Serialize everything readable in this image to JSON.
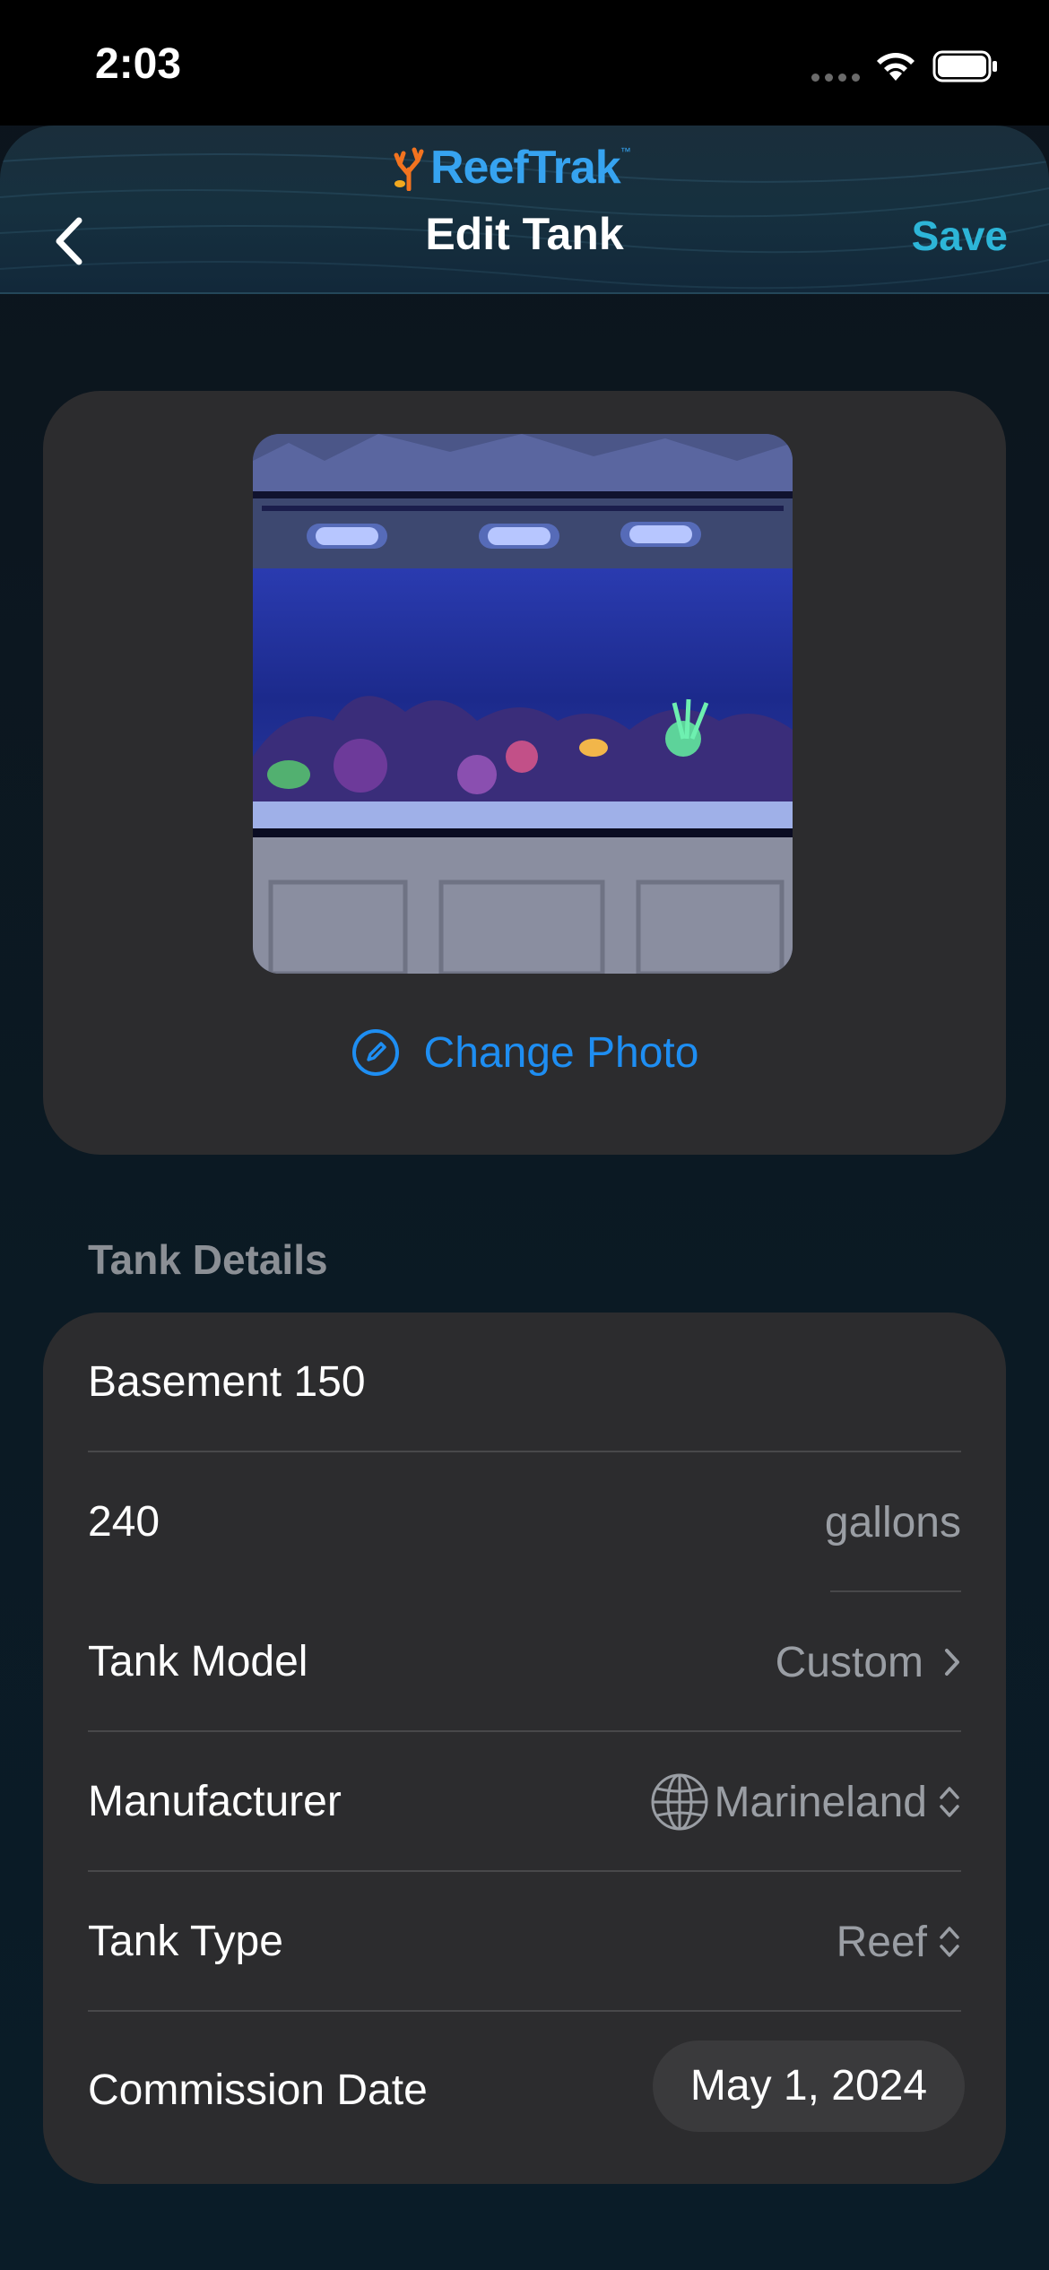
{
  "status_bar": {
    "time": "2:03"
  },
  "header": {
    "logo_text": "ReefTrak",
    "logo_tm": "™",
    "title": "Edit Tank",
    "save_label": "Save",
    "back_icon": "chevron-left-icon"
  },
  "photo_card": {
    "change_photo_label": "Change Photo",
    "icon": "pencil-circle-icon"
  },
  "tank_details": {
    "section_title": "Tank Details",
    "name_value": "Basement 150",
    "volume_value": "240",
    "volume_unit": "gallons",
    "rows": [
      {
        "label": "Tank Model",
        "value": "Custom",
        "icon": "chevron-right-icon"
      },
      {
        "label": "Manufacturer",
        "value": "Marineland",
        "icon": "chevron-up-down-icon",
        "leading_icon": "globe-icon"
      },
      {
        "label": "Tank Type",
        "value": "Reef",
        "icon": "chevron-up-down-icon"
      },
      {
        "label": "Commission Date",
        "value": "May 1, 2024"
      }
    ]
  },
  "colors": {
    "accent_blue": "#1e8ef2",
    "save_teal": "#2db5d8",
    "card_bg": "#2c2c2e",
    "secondary_text": "#9a9ea4"
  }
}
